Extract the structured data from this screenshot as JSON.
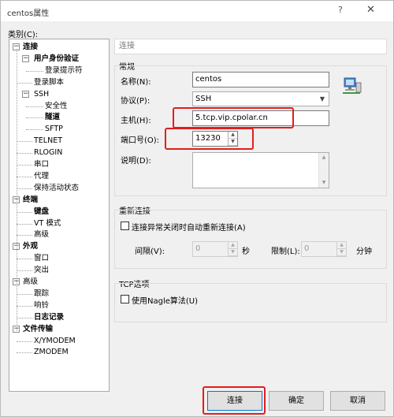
{
  "window": {
    "title": "centos属性",
    "help": "?",
    "close": "✕"
  },
  "category_label": "类别(C):",
  "tree": [
    {
      "label": "连接",
      "bold": true,
      "exp": "−"
    },
    {
      "label": "用户身份验证",
      "bold": true,
      "exp": "−"
    },
    {
      "label": "登录提示符"
    },
    {
      "label": "登录脚本"
    },
    {
      "label": "SSH",
      "exp": "−"
    },
    {
      "label": "安全性"
    },
    {
      "label": "隧道",
      "bold": true
    },
    {
      "label": "SFTP"
    },
    {
      "label": "TELNET"
    },
    {
      "label": "RLOGIN"
    },
    {
      "label": "串口"
    },
    {
      "label": "代理"
    },
    {
      "label": "保持活动状态"
    },
    {
      "label": "终端",
      "bold": true,
      "exp": "−"
    },
    {
      "label": "键盘",
      "bold": true
    },
    {
      "label": "VT 模式"
    },
    {
      "label": "高级"
    },
    {
      "label": "外观",
      "bold": true,
      "exp": "−"
    },
    {
      "label": "窗口"
    },
    {
      "label": "突出"
    },
    {
      "label": "高级",
      "exp": "−"
    },
    {
      "label": "跟踪"
    },
    {
      "label": "响铃"
    },
    {
      "label": "日志记录",
      "bold": true
    },
    {
      "label": "文件传输",
      "bold": true,
      "exp": "−"
    },
    {
      "label": "X/YMODEM"
    },
    {
      "label": "ZMODEM"
    }
  ],
  "panel_title": "连接",
  "general": {
    "section": "常规",
    "name_label": "名称(N):",
    "name_value": "centos",
    "protocol_label": "协议(P):",
    "protocol_value": "SSH",
    "host_label": "主机(H):",
    "host_value": "5.tcp.vip.cpolar.cn",
    "port_label": "端口号(O):",
    "port_value": "13230",
    "desc_label": "说明(D):",
    "desc_value": ""
  },
  "reconnect": {
    "section": "重新连接",
    "checkbox_label": "连接异常关闭时自动重新连接(A)",
    "interval_label": "间隔(V):",
    "interval_value": "0",
    "interval_unit": "秒",
    "limit_label": "限制(L):",
    "limit_value": "0",
    "limit_unit": "分钟"
  },
  "tcp": {
    "section": "TCP选项",
    "nagle_label": "使用Nagle算法(U)"
  },
  "buttons": {
    "connect": "连接",
    "ok": "确定",
    "cancel": "取消"
  },
  "colors": {
    "highlight": "#e41d1d",
    "focus": "#0078d7"
  }
}
